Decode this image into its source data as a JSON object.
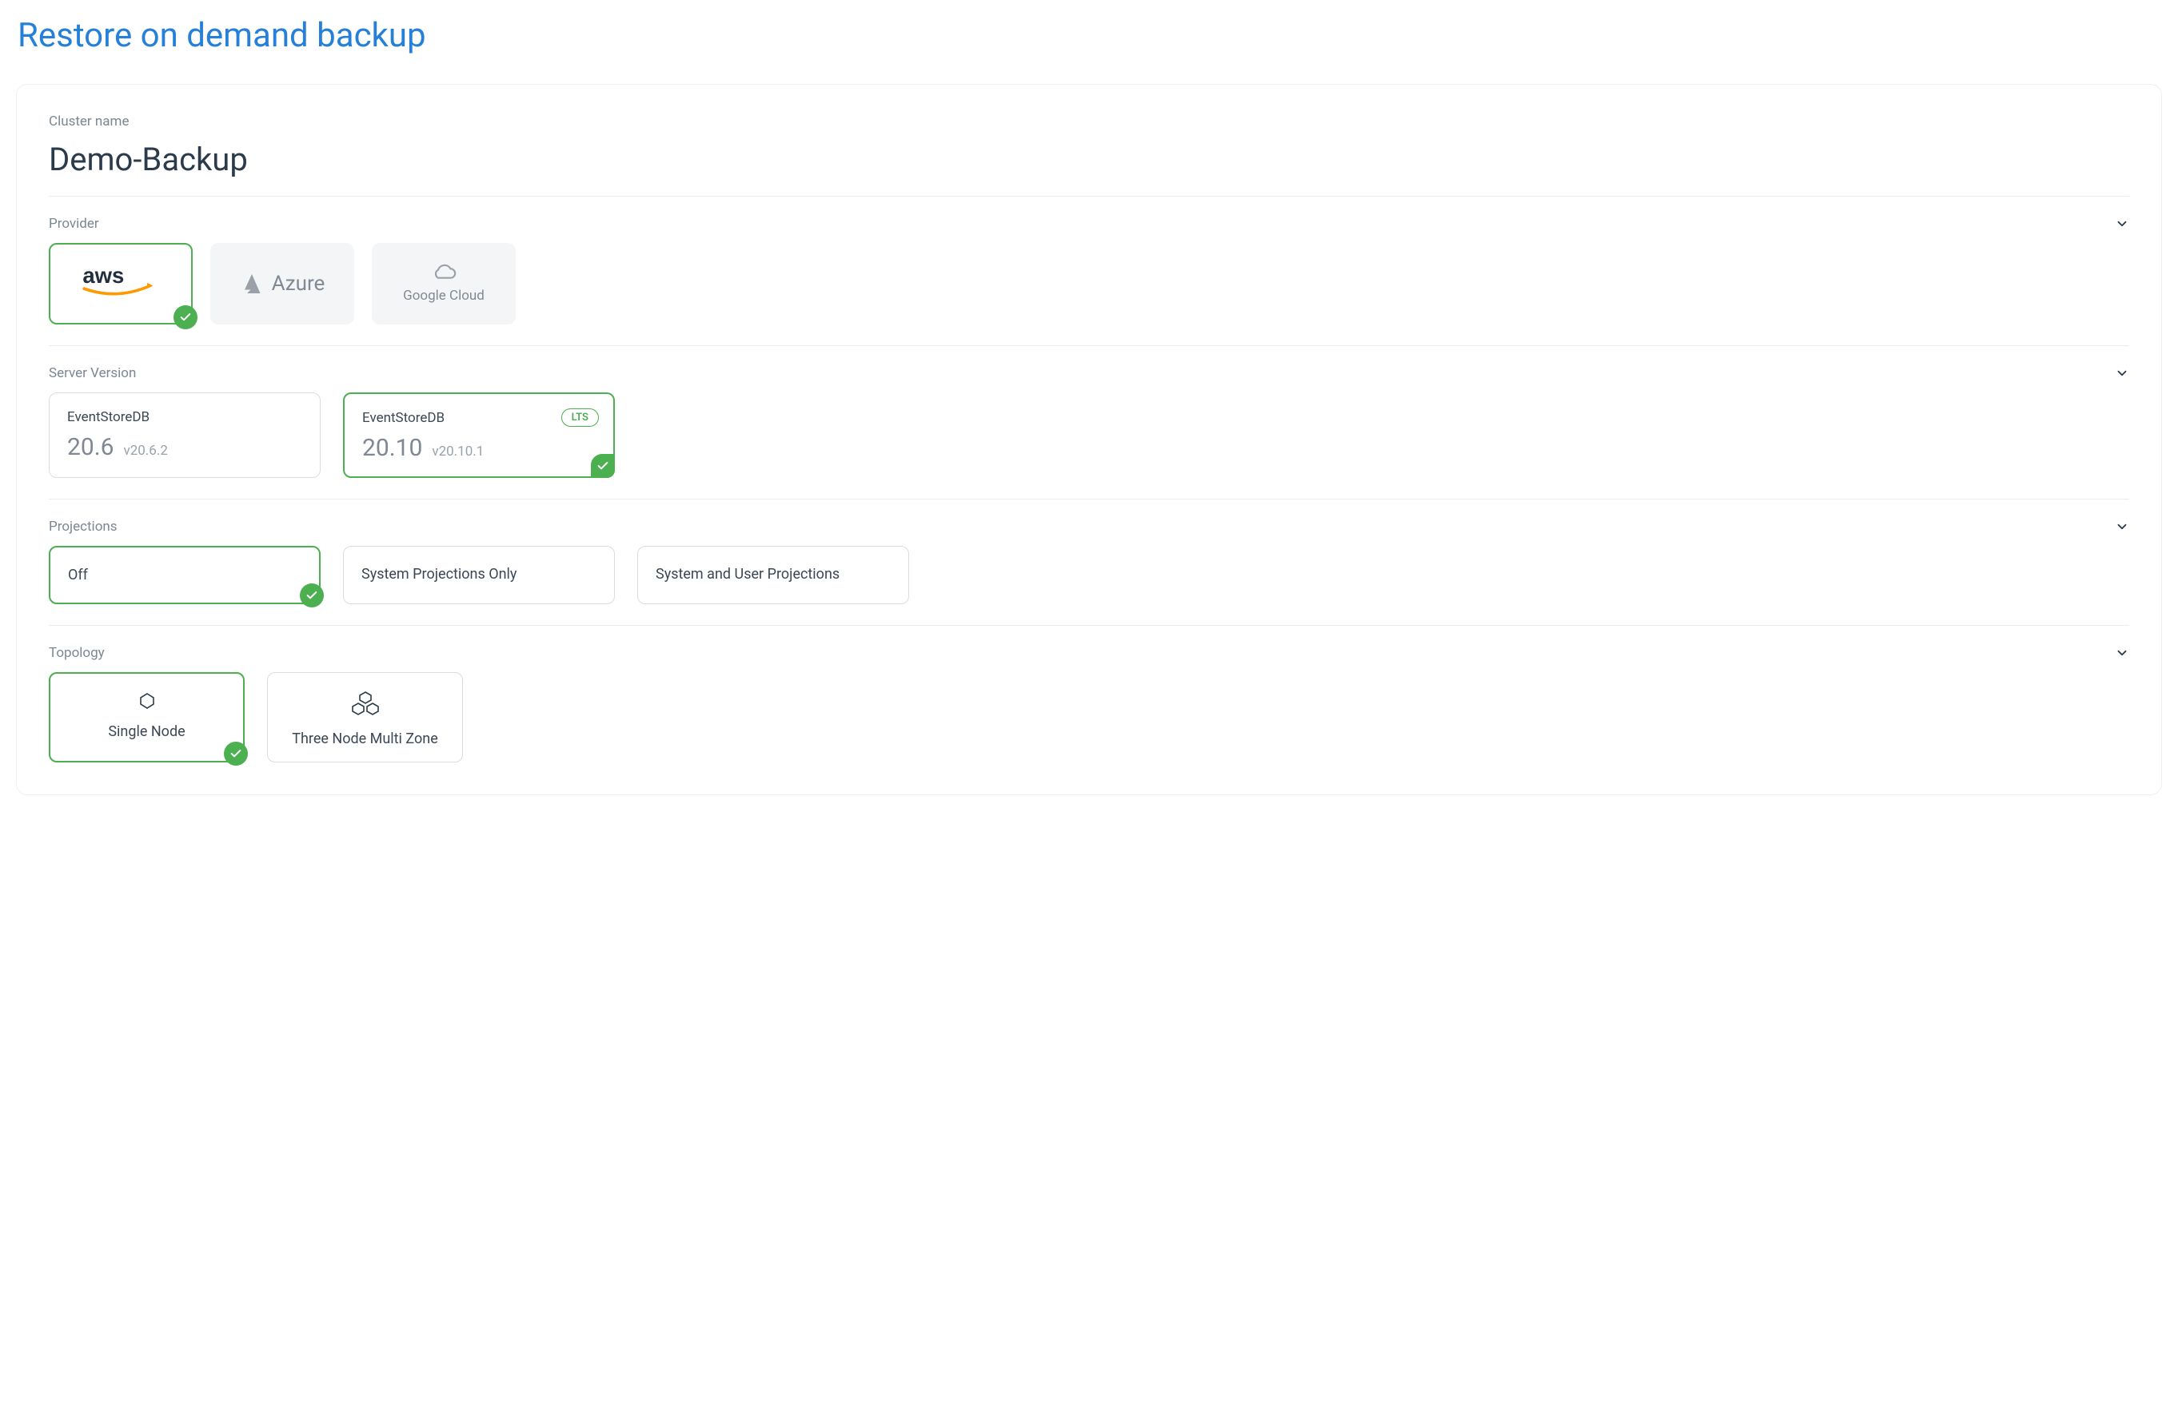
{
  "page_title": "Restore on demand backup",
  "cluster": {
    "label": "Cluster name",
    "value": "Demo-Backup"
  },
  "provider": {
    "label": "Provider",
    "options": [
      {
        "id": "aws",
        "name": "AWS",
        "selected": true
      },
      {
        "id": "azure",
        "name": "Azure",
        "selected": false
      },
      {
        "id": "gcloud",
        "name": "Google Cloud",
        "selected": false
      }
    ]
  },
  "server_version": {
    "label": "Server Version",
    "options": [
      {
        "product": "EventStoreDB",
        "version": "20.6",
        "subversion": "v20.6.2",
        "lts": false,
        "selected": false
      },
      {
        "product": "EventStoreDB",
        "version": "20.10",
        "subversion": "v20.10.1",
        "lts": true,
        "selected": true
      }
    ],
    "lts_label": "LTS"
  },
  "projections": {
    "label": "Projections",
    "options": [
      {
        "label": "Off",
        "selected": true
      },
      {
        "label": "System Projections Only",
        "selected": false
      },
      {
        "label": "System and User Projections",
        "selected": false
      }
    ]
  },
  "topology": {
    "label": "Topology",
    "options": [
      {
        "label": "Single Node",
        "icon": "single",
        "selected": true
      },
      {
        "label": "Three Node Multi Zone",
        "icon": "multi",
        "selected": false
      }
    ]
  }
}
